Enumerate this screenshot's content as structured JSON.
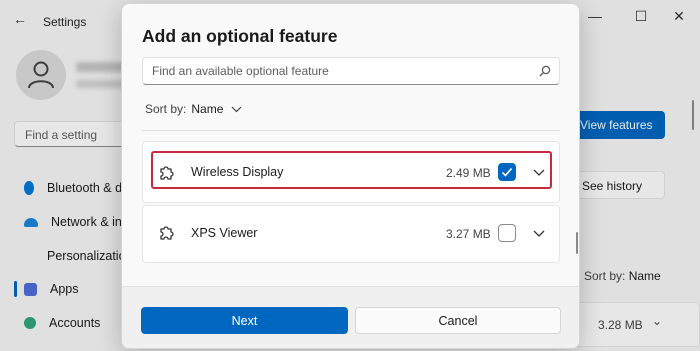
{
  "background": {
    "window_title": "Settings",
    "search_placeholder": "Find a setting",
    "nav_items": [
      {
        "label": "Bluetooth & d",
        "color": "#0078d4"
      },
      {
        "label": "Network & in",
        "color": "#1a86d9"
      },
      {
        "label": "Personalizatio",
        "color": "#d9842b"
      },
      {
        "label": "Apps",
        "color": "#4f6bd8"
      },
      {
        "label": "Accounts",
        "color": "#2fa37a"
      }
    ],
    "view_features_label": "View features",
    "see_history_label": "See history",
    "sort_label": "Sort by:",
    "sort_value": "Name",
    "item_size": "3.28 MB",
    "window_controls": {
      "minimize": "—",
      "maximize": "☐",
      "close": "✕"
    },
    "back_icon": "back-arrow-icon"
  },
  "dialog": {
    "title": "Add an optional feature",
    "search": {
      "placeholder": "Find an available optional feature",
      "value": ""
    },
    "sort": {
      "label": "Sort by:",
      "value": "Name"
    },
    "features": [
      {
        "name": "Wireless Display",
        "size": "2.49 MB",
        "checked": true,
        "highlighted": true,
        "icon": "puzzle-icon"
      },
      {
        "name": "XPS Viewer",
        "size": "3.27 MB",
        "checked": false,
        "highlighted": false,
        "icon": "puzzle-icon"
      }
    ],
    "next_label": "Next",
    "cancel_label": "Cancel"
  },
  "colors": {
    "accent": "#0067c0",
    "highlight": "#c62a3c"
  }
}
